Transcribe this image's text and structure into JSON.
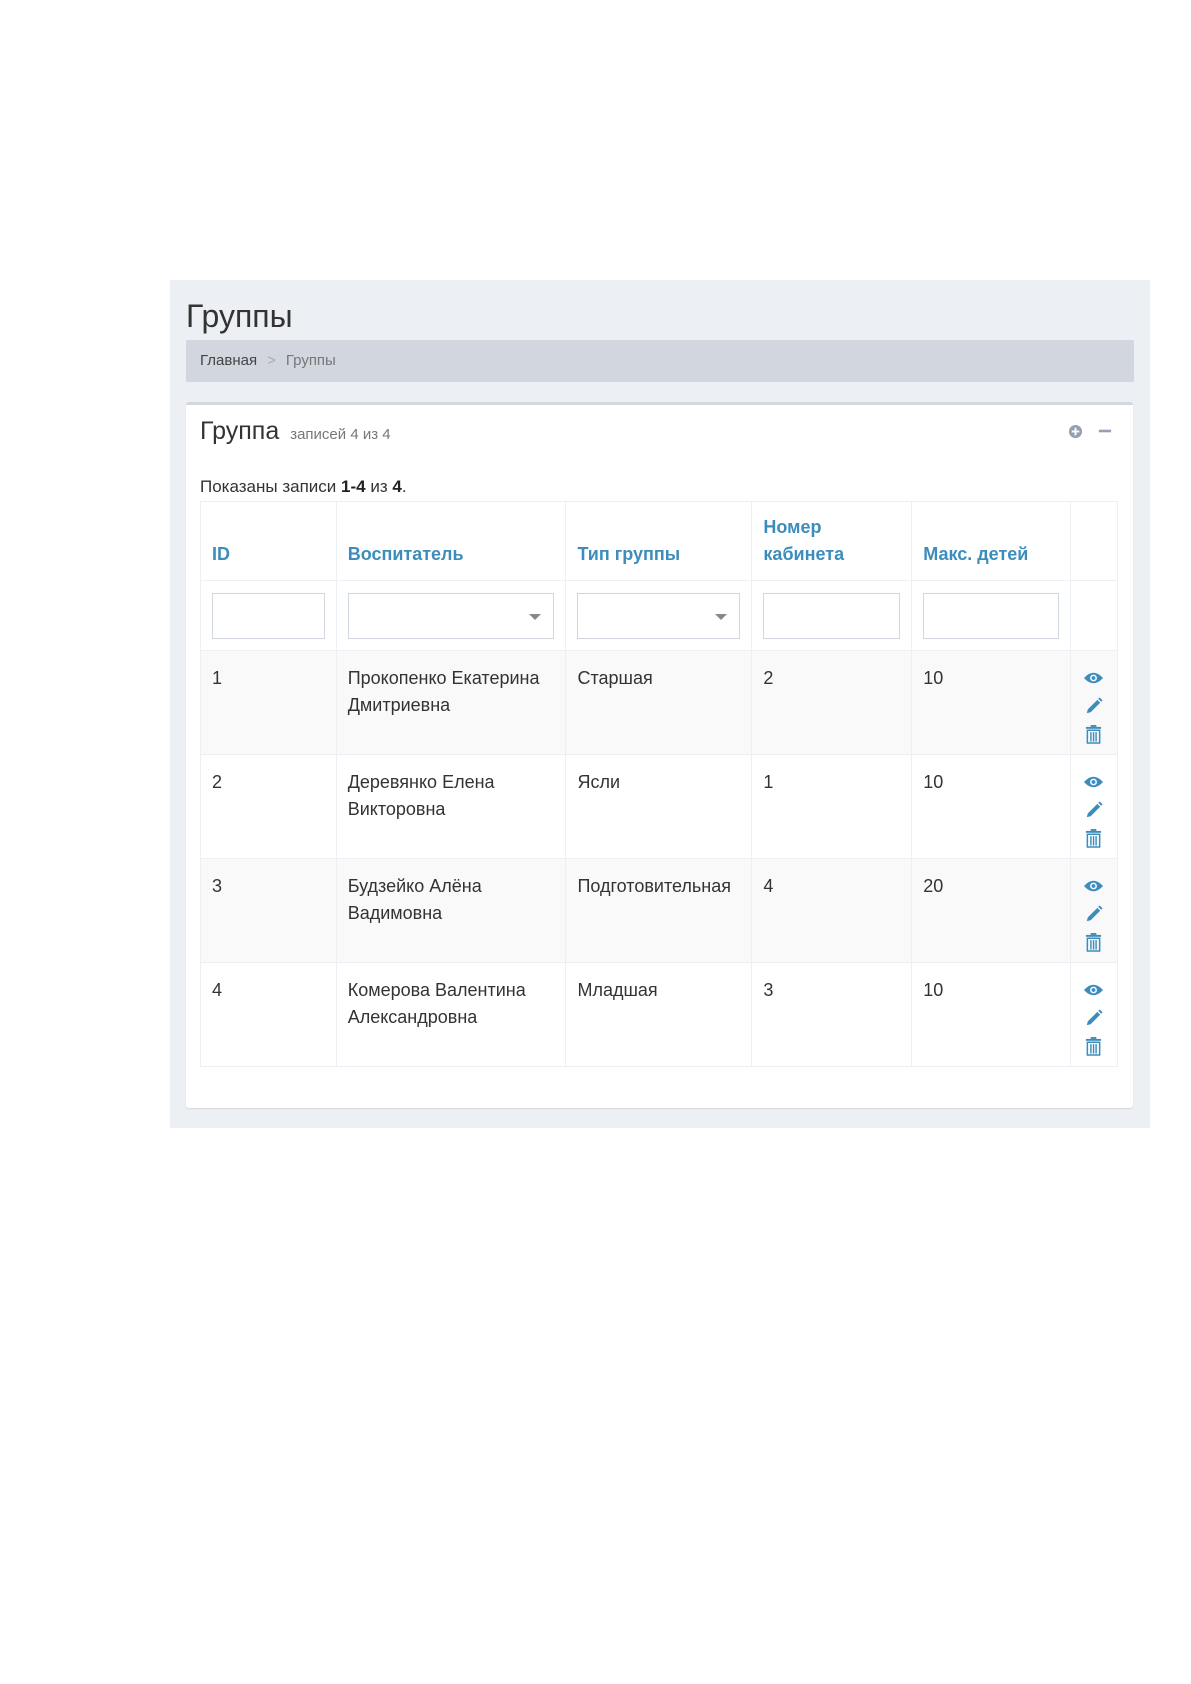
{
  "page": {
    "title": "Группы",
    "breadcrumb": {
      "home": "Главная",
      "separator": ">",
      "current": "Группы"
    }
  },
  "box": {
    "title": "Группа",
    "subtitle": "записей 4 из 4",
    "tools": {
      "expand_icon": "plus-circle-icon",
      "collapse_icon": "minus-icon"
    }
  },
  "summary": {
    "prefix": "Показаны записи",
    "range": "1-4",
    "middle": "из",
    "total": "4",
    "suffix": "."
  },
  "table": {
    "headers": [
      "ID",
      "Воспитатель",
      "Тип группы",
      "Номер кабинета",
      "Макс. детей"
    ],
    "rows": [
      {
        "id": "1",
        "teacher": "Прокопенко Екатерина Дмитриевна",
        "type": "Старшая",
        "room": "2",
        "max": "10"
      },
      {
        "id": "2",
        "teacher": "Деревянко Елена Викторовна",
        "type": "Ясли",
        "room": "1",
        "max": "10"
      },
      {
        "id": "3",
        "teacher": "Будзейко Алёна Вадимовна",
        "type": "Подготовительная",
        "room": "4",
        "max": "20"
      },
      {
        "id": "4",
        "teacher": "Комерова Валентина Александровна",
        "type": "Младшая",
        "room": "3",
        "max": "10"
      }
    ],
    "row_actions": [
      "eye-icon",
      "pencil-icon",
      "trash-icon"
    ]
  },
  "colors": {
    "accent": "#3c8dbc",
    "breadcrumb_bg": "#d2d6de",
    "page_bg": "#ecf0f5"
  }
}
